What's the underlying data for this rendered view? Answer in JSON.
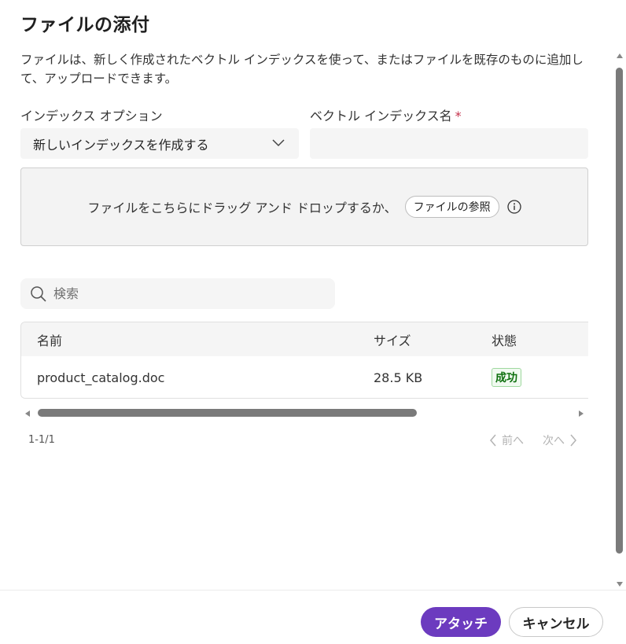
{
  "dialog": {
    "title": "ファイルの添付",
    "description": "ファイルは、新しく作成されたベクトル インデックスを使って、またはファイルを既存のものに追加して、アップロードできます。"
  },
  "form": {
    "index_option_label": "インデックス オプション",
    "index_option_value": "新しいインデックスを作成する",
    "index_name_label": "ベクトル インデックス名",
    "required_mark": "*",
    "index_name_value": ""
  },
  "dropzone": {
    "text": "ファイルをこちらにドラッグ アンド ドロップするか、",
    "browse_label": "ファイルの参照"
  },
  "search": {
    "placeholder": "検索"
  },
  "table": {
    "columns": [
      "名前",
      "サイズ",
      "状態"
    ],
    "rows": [
      {
        "name": "product_catalog.doc",
        "size": "28.5 KB",
        "status": "成功"
      }
    ]
  },
  "pagination": {
    "count": "1-1/1",
    "prev_label": "前へ",
    "next_label": "次へ"
  },
  "footer": {
    "attach_label": "アタッチ",
    "cancel_label": "キャンセル"
  },
  "colors": {
    "primary": "#6c3bbf",
    "success_text": "#0e700e",
    "success_bg": "#f1faf1",
    "required": "#c4314b"
  },
  "icons": {
    "select": "chevron-down-icon",
    "info": "info-icon",
    "search": "search-icon",
    "prev": "chevron-left-icon",
    "next": "chevron-right-icon"
  }
}
